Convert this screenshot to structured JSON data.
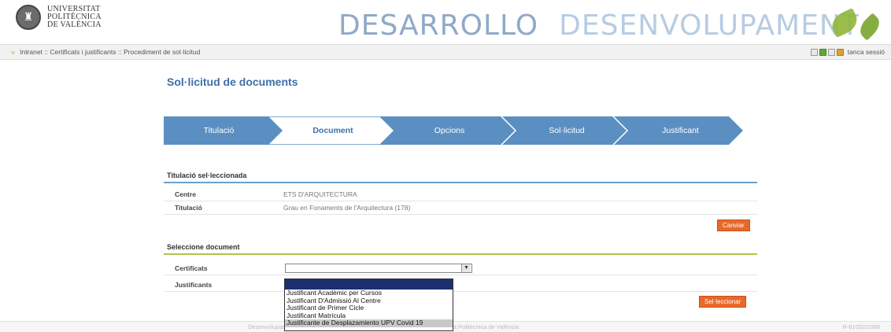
{
  "header": {
    "logo_lines": [
      "UNIVERSITAT",
      "POLITÈCNICA",
      "DE VALÈNCIA"
    ],
    "banner_left": "DESARROLLO",
    "banner_right": "DESENVOLUPAMENT"
  },
  "breadcrumb": {
    "arrow": "»",
    "items": [
      "Intranet",
      "Certificats i justificants",
      "Procediment de sol·licitud"
    ],
    "separator": "::",
    "logout_label": "tanca sessió"
  },
  "page": {
    "title": "Sol·licitud de documents"
  },
  "steps": [
    {
      "label": "Titulació",
      "active": false
    },
    {
      "label": "Document",
      "active": true
    },
    {
      "label": "Opcions",
      "active": false
    },
    {
      "label": "Sol·licitud",
      "active": false
    },
    {
      "label": "Justificant",
      "active": false
    }
  ],
  "selected_section": {
    "title": "Titulació sel·leccionada",
    "rows": [
      {
        "label": "Centre",
        "value": "ETS D'ARQUITECTURA"
      },
      {
        "label": "Titulació",
        "value": "Grau en Fonaments de l'Arquitectura (178)"
      }
    ],
    "change_button": "Canviar"
  },
  "document_section": {
    "title": "Seleccione document",
    "certificats_label": "Certificats",
    "certificats_value": "",
    "justificants_label": "Justificants",
    "select_button": "Sel·leccionar",
    "dropdown_options": [
      "Justificant Acadèmic per Cursos",
      "Justificant D'Admissió Al Centre",
      "Justificant de Primer Cicle",
      "Justificant Matrícula",
      "Justificante de Desplazamiento UPV Covid 19"
    ]
  },
  "footer": {
    "left": "Desenvolupat per l'Àrea de Sistemes d'Informació i Comunicacions - Universitat Politècnica de València",
    "right": "R-61052/2008"
  },
  "colors": {
    "accent_blue": "#3d6fa8",
    "step_blue": "#5b8fc2",
    "orange_button": "#e8692a",
    "green_rule": "#a9c74b"
  }
}
